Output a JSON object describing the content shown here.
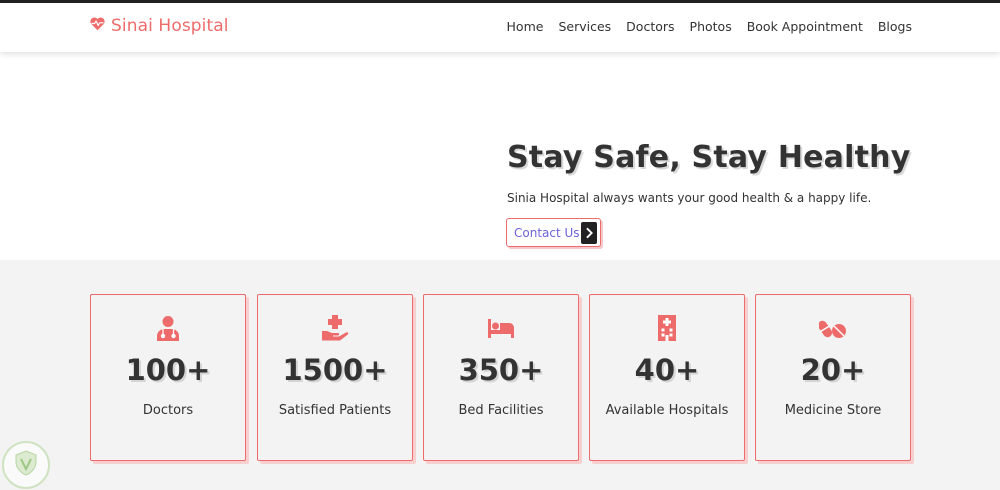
{
  "brand": {
    "name": "Sinai Hospital",
    "icon": "heart-pulse-icon",
    "color": "#ee6b6b"
  },
  "nav": {
    "items": [
      {
        "label": "Home"
      },
      {
        "label": "Services"
      },
      {
        "label": "Doctors"
      },
      {
        "label": "Photos"
      },
      {
        "label": "Book Appointment"
      },
      {
        "label": "Blogs"
      }
    ]
  },
  "hero": {
    "title": "Stay Safe, Stay Healthy",
    "subtitle": "Sinia Hospital always wants your good health & a happy life.",
    "cta_label": "Contact Us",
    "cta_icon": "chevron-right-icon"
  },
  "stats": [
    {
      "icon": "doctor-icon",
      "value": "100+",
      "label": "Doctors"
    },
    {
      "icon": "hand-medical-icon",
      "value": "1500+",
      "label": "Satisfied Patients"
    },
    {
      "icon": "bed-icon",
      "value": "350+",
      "label": "Bed Facilities"
    },
    {
      "icon": "hospital-building-icon",
      "value": "40+",
      "label": "Available Hospitals"
    },
    {
      "icon": "pills-icon",
      "value": "20+",
      "label": "Medicine Store"
    }
  ],
  "colors": {
    "accent": "#ee6b6b",
    "link": "#6b63d6",
    "stats_bg": "#f3f3f3"
  }
}
